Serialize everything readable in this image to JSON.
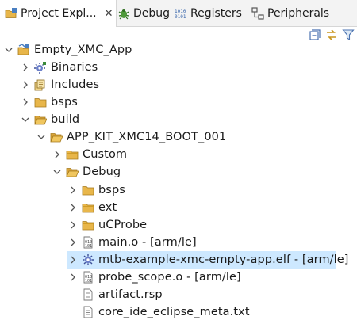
{
  "tabs": [
    {
      "label": "Project Expl...",
      "icon": "project-explorer-icon",
      "active": true
    },
    {
      "label": "Debug",
      "icon": "debug-bug-icon"
    },
    {
      "label": "Registers",
      "icon": "registers-icon"
    },
    {
      "label": "Peripherals",
      "icon": "peripherals-icon"
    }
  ],
  "toolbar": {
    "collapse_all": "collapse-all-icon",
    "link_editor": "link-with-editor-icon",
    "filter": "filter-icon"
  },
  "tree": [
    {
      "label": "Empty_XMC_App",
      "icon": "project-icon",
      "expanded": true
    },
    {
      "label": "Binaries",
      "icon": "binaries-icon",
      "expanded": false
    },
    {
      "label": "Includes",
      "icon": "includes-icon",
      "expanded": false
    },
    {
      "label": "bsps",
      "icon": "folder-icon",
      "expanded": false
    },
    {
      "label": "build",
      "icon": "folder-icon",
      "expanded": true
    },
    {
      "label": "APP_KIT_XMC14_BOOT_001",
      "icon": "folder-icon",
      "expanded": true
    },
    {
      "label": "Custom",
      "icon": "folder-icon",
      "expanded": false
    },
    {
      "label": "Debug",
      "icon": "folder-icon",
      "expanded": true
    },
    {
      "label": "bsps",
      "icon": "folder-icon",
      "expanded": false
    },
    {
      "label": "ext",
      "icon": "folder-icon",
      "expanded": false
    },
    {
      "label": "uCProbe",
      "icon": "folder-icon",
      "expanded": false
    },
    {
      "label": "main.o - [arm/le]",
      "icon": "object-file-icon",
      "expanded": false
    },
    {
      "label": "mtb-example-xmc-empty-app.elf - [arm/le]",
      "icon": "executable-file-icon",
      "expanded": false,
      "selected": true
    },
    {
      "label": "probe_scope.o - [arm/le]",
      "icon": "object-file-icon",
      "expanded": false
    },
    {
      "label": "artifact.rsp",
      "icon": "text-file-icon"
    },
    {
      "label": "core_ide_eclipse_meta.txt",
      "icon": "text-file-icon"
    }
  ]
}
